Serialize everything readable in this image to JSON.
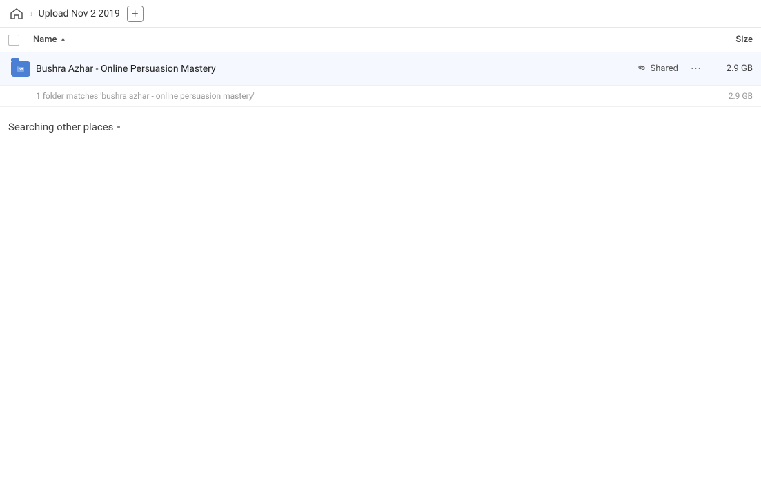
{
  "header": {
    "home_title": "home",
    "breadcrumb_title": "Upload Nov 2 2019",
    "add_button_label": "+"
  },
  "table": {
    "name_col_label": "Name",
    "size_col_label": "Size",
    "sort_indicator": "▲"
  },
  "file_row": {
    "name": "Bushra Azhar - Online Persuasion Mastery",
    "shared_label": "Shared",
    "more_label": "···",
    "size": "2.9 GB"
  },
  "summary": {
    "text": "1 folder matches 'bushra azhar - online persuasion mastery'",
    "size": "2.9 GB"
  },
  "searching": {
    "title": "Searching other places"
  }
}
